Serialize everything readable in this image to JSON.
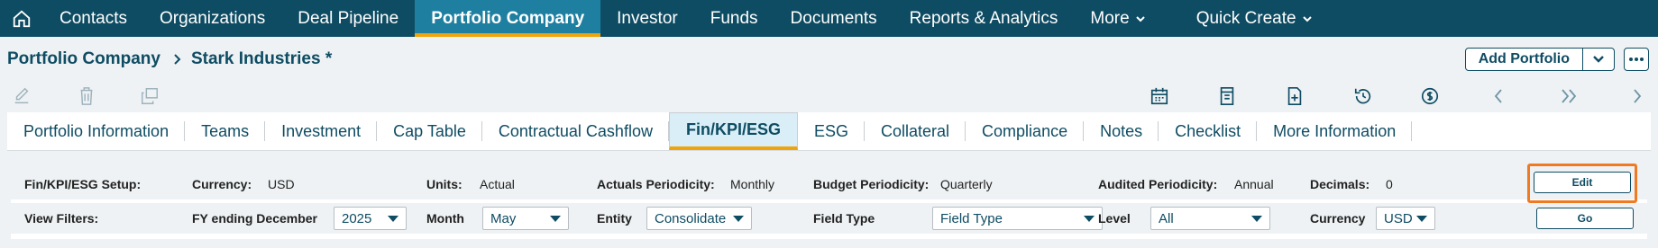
{
  "nav": {
    "items": [
      "Contacts",
      "Organizations",
      "Deal Pipeline",
      "Portfolio Company",
      "Investor",
      "Funds",
      "Documents",
      "Reports & Analytics"
    ],
    "more": "More",
    "quick_create": "Quick Create"
  },
  "breadcrumb": {
    "root": "Portfolio Company",
    "current": "Stark Industries *"
  },
  "title_actions": {
    "add_portfolio": "Add Portfolio"
  },
  "tabs": [
    "Portfolio Information",
    "Teams",
    "Investment",
    "Cap Table",
    "Contractual Cashflow",
    "Fin/KPI/ESG",
    "ESG",
    "Collateral",
    "Compliance",
    "Notes",
    "Checklist",
    "More Information"
  ],
  "setup": {
    "title": "Fin/KPI/ESG Setup:",
    "currency_label": "Currency:",
    "currency_value": "USD",
    "units_label": "Units:",
    "units_value": "Actual",
    "actuals_label": "Actuals Periodicity:",
    "actuals_value": "Monthly",
    "budget_label": "Budget Periodicity:",
    "budget_value": "Quarterly",
    "audited_label": "Audited Periodicity:",
    "audited_value": "Annual",
    "decimals_label": "Decimals:",
    "decimals_value": "0",
    "edit_label": "Edit"
  },
  "filters": {
    "title": "View Filters:",
    "fy_label": "FY ending December",
    "fy_value": "2025",
    "month_label": "Month",
    "month_value": "May",
    "entity_label": "Entity",
    "entity_value": "Consolidate",
    "field_type_label": "Field Type",
    "field_type_value": "Field Type",
    "level_label": "Level",
    "level_value": "All",
    "currency_label": "Currency",
    "currency_value": "USD",
    "go_label": "Go"
  },
  "colors": {
    "nav_bg": "#0e4c63",
    "nav_active": "#1e7fa0",
    "accent": "#f0a30a",
    "highlight": "#f07a22"
  }
}
